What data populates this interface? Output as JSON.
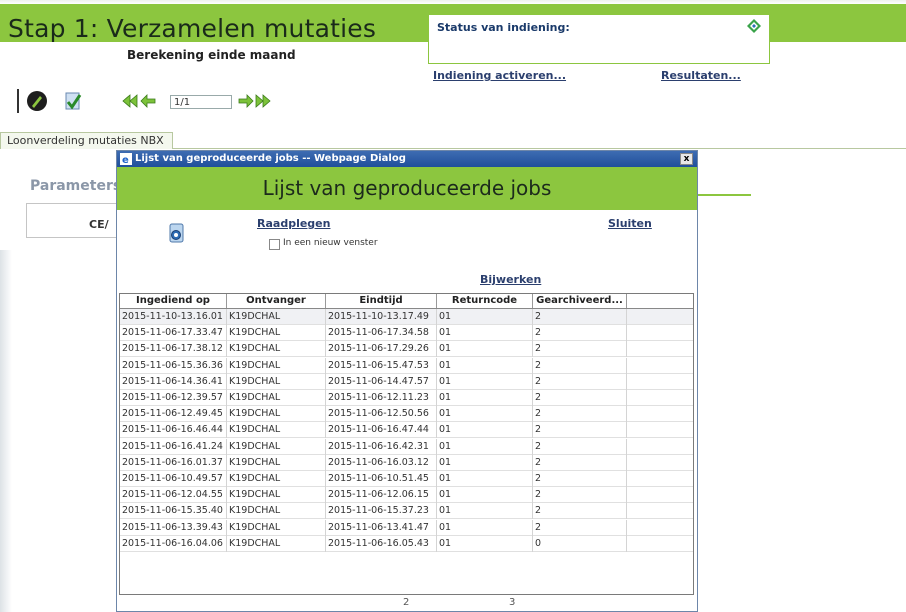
{
  "page": {
    "title": "Stap 1: Verzamelen mutaties",
    "subtitle": "Berekening einde maand",
    "status_label": "Status van indiening:",
    "link_activate": "Indiening activeren...",
    "link_results": "Resultaten...",
    "pager_value": "1/1",
    "tab_label": "Loonverdeling mutaties NBX",
    "params_title": "Parameters",
    "params_cell": "CE/",
    "accent_color": "#8cc63f"
  },
  "dialog": {
    "window_title": "Lijst van geproduceerde jobs -- Webpage Dialog",
    "close_label": "x",
    "heading": "Lijst van geproduceerde jobs",
    "link_view": "Raadplegen",
    "checkbox_label": "In een nieuw venster",
    "link_close": "Sluiten",
    "link_refresh": "Bijwerken",
    "columns": [
      "Ingediend op",
      "Ontvanger",
      "Eindtijd",
      "Returncode",
      "Gearchiveerd..."
    ],
    "rows": [
      [
        "2015-11-10-13.16.01",
        "K19DCHAL",
        "2015-11-10-13.17.49",
        "01",
        "2"
      ],
      [
        "2015-11-06-17.33.47",
        "K19DCHAL",
        "2015-11-06-17.34.58",
        "01",
        "2"
      ],
      [
        "2015-11-06-17.38.12",
        "K19DCHAL",
        "2015-11-06-17.29.26",
        "01",
        "2"
      ],
      [
        "2015-11-06-15.36.36",
        "K19DCHAL",
        "2015-11-06-15.47.53",
        "01",
        "2"
      ],
      [
        "2015-11-06-14.36.41",
        "K19DCHAL",
        "2015-11-06-14.47.57",
        "01",
        "2"
      ],
      [
        "2015-11-06-12.39.57",
        "K19DCHAL",
        "2015-11-06-12.11.23",
        "01",
        "2"
      ],
      [
        "2015-11-06-12.49.45",
        "K19DCHAL",
        "2015-11-06-12.50.56",
        "01",
        "2"
      ],
      [
        "2015-11-06-16.46.44",
        "K19DCHAL",
        "2015-11-06-16.47.44",
        "01",
        "2"
      ],
      [
        "2015-11-06-16.41.24",
        "K19DCHAL",
        "2015-11-06-16.42.31",
        "01",
        "2"
      ],
      [
        "2015-11-06-16.01.37",
        "K19DCHAL",
        "2015-11-06-16.03.12",
        "01",
        "2"
      ],
      [
        "2015-11-06-10.49.57",
        "K19DCHAL",
        "2015-11-06-10.51.45",
        "01",
        "2"
      ],
      [
        "2015-11-06-12.04.55",
        "K19DCHAL",
        "2015-11-06-12.06.15",
        "01",
        "2"
      ],
      [
        "2015-11-06-15.35.40",
        "K19DCHAL",
        "2015-11-06-15.37.23",
        "01",
        "2"
      ],
      [
        "2015-11-06-13.39.43",
        "K19DCHAL",
        "2015-11-06-13.41.47",
        "01",
        "2"
      ],
      [
        "2015-11-06-16.04.06",
        "K19DCHAL",
        "2015-11-06-16.05.43",
        "01",
        "0"
      ]
    ],
    "footer_values": [
      "2",
      "3"
    ]
  }
}
